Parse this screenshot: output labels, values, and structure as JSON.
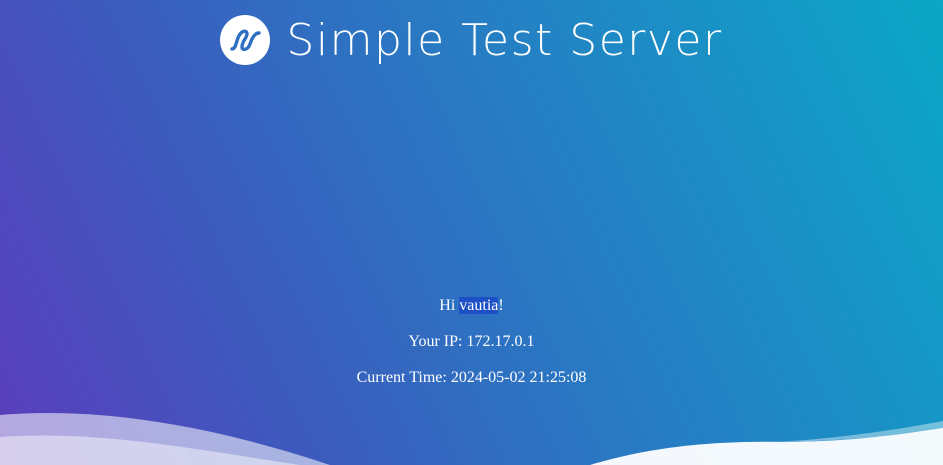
{
  "header": {
    "title": "Simple Test Server",
    "logo_icon": "wave-logo-icon"
  },
  "greeting": {
    "prefix": "Hi ",
    "username": "vautia",
    "suffix": "!"
  },
  "ip": {
    "label": "Your IP: ",
    "value": "172.17.0.1"
  },
  "time": {
    "label": "Current Time: ",
    "value": "2024-05-02 21:25:08"
  },
  "colors": {
    "gradient_start": "#5b3dbd",
    "gradient_end": "#0aa7c6",
    "selection_highlight": "#1d4fc6",
    "text": "#ffffff"
  }
}
